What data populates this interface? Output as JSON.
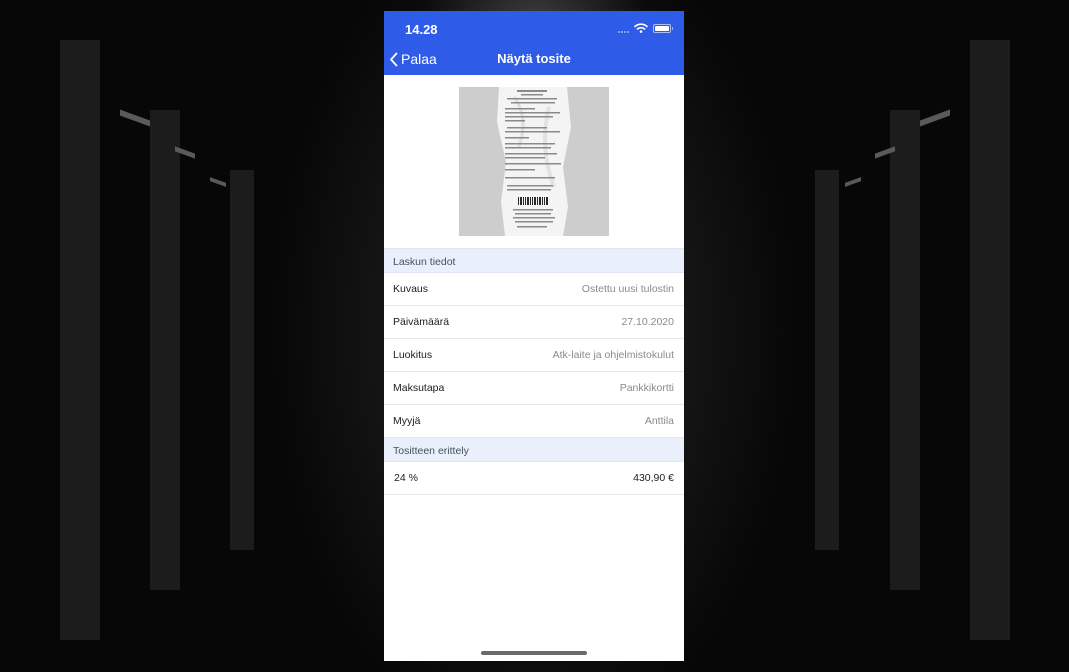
{
  "status_bar": {
    "time": "14.28"
  },
  "nav": {
    "back_label": "Palaa",
    "title": "Näytä tosite"
  },
  "receipt_image": {
    "icon": "receipt-photo"
  },
  "invoice_details": {
    "header": "Laskun tiedot",
    "rows": [
      {
        "label": "Kuvaus",
        "value": "Ostettu uusi tulostin"
      },
      {
        "label": "Päivämäärä",
        "value": "27.10.2020"
      },
      {
        "label": "Luokitus",
        "value": "Atk-laite ja ohjelmistokulut"
      },
      {
        "label": "Maksutapa",
        "value": "Pankkikortti"
      },
      {
        "label": "Myyjä",
        "value": "Anttila"
      }
    ]
  },
  "breakdown": {
    "header": "Tositteen erittely",
    "rows": [
      {
        "vat": "24 %",
        "amount": "430,90 €"
      }
    ]
  },
  "colors": {
    "accent": "#2e5be8",
    "section_bg": "#e9f0fb"
  }
}
